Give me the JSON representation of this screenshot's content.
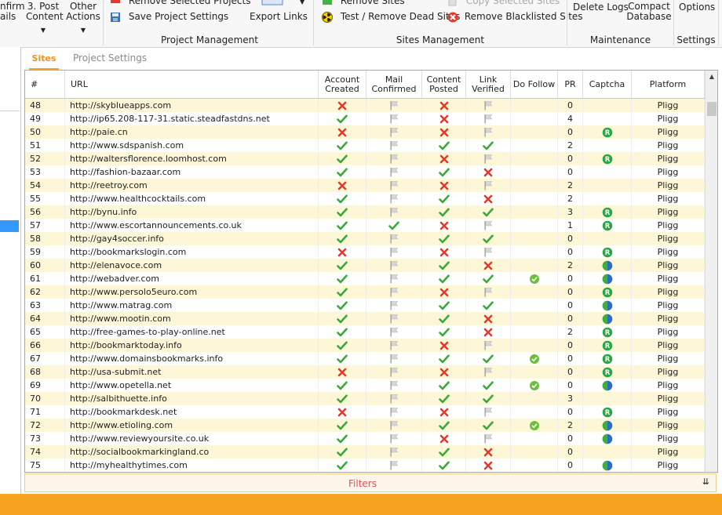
{
  "ribbon": {
    "left_partial_1": "nfirm",
    "left_partial_2": "ails",
    "post_content": [
      "3. Post",
      "Content"
    ],
    "other_actions": [
      "Other",
      "Actions"
    ],
    "remove_selected_projects": "Remove Selected Projects",
    "save_project_settings": "Save Project Settings",
    "export_links": "Export Links",
    "remove_sites": "Remove Sites",
    "copy_selected_sites": "Copy Selected Sites",
    "test_remove_dead_sites": "Test / Remove Dead Sites",
    "remove_blacklisted_sites": "Remove Blacklisted Sites",
    "delete_logs": "Delete Logs",
    "compact_database": [
      "Compact",
      "Database"
    ],
    "options": "Options",
    "groups": {
      "project_management": "Project Management",
      "sites_management": "Sites Management",
      "maintenance": "Maintenance",
      "settings": "Settings"
    }
  },
  "tabs": {
    "sites": "Sites",
    "project_settings": "Project Settings"
  },
  "columns": {
    "num": "#",
    "url": "URL",
    "account_created": [
      "Account",
      "Created"
    ],
    "mail_confirmed": [
      "Mail",
      "Confirmed"
    ],
    "content_posted": [
      "Content",
      "Posted"
    ],
    "link_verified": [
      "Link",
      "Verified"
    ],
    "do_follow": "Do Follow",
    "pr": "PR",
    "captcha": "Captcha",
    "platform": "Platform"
  },
  "rows": [
    {
      "n": "48",
      "url": "http://skyblueapps.com",
      "ac": "x",
      "mc": "flag",
      "cp": "x",
      "lv": "flag",
      "df": "",
      "pr": "0",
      "cap": "",
      "pl": "Pligg"
    },
    {
      "n": "49",
      "url": "http://ip65.208-117-31.static.steadfastdns.net",
      "ac": "check",
      "mc": "flag",
      "cp": "x",
      "lv": "flag",
      "df": "",
      "pr": "4",
      "cap": "",
      "pl": "Pligg"
    },
    {
      "n": "50",
      "url": "http://paie.cn",
      "ac": "x",
      "mc": "flag",
      "cp": "x",
      "lv": "flag",
      "df": "",
      "pr": "0",
      "cap": "R",
      "pl": "Pligg"
    },
    {
      "n": "51",
      "url": "http://www.sdspanish.com",
      "ac": "check",
      "mc": "flag",
      "cp": "check",
      "lv": "check",
      "df": "",
      "pr": "2",
      "cap": "",
      "pl": "Pligg"
    },
    {
      "n": "52",
      "url": "http://waltersflorence.loomhost.com",
      "ac": "check",
      "mc": "flag",
      "cp": "x",
      "lv": "flag",
      "df": "",
      "pr": "0",
      "cap": "R",
      "pl": "Pligg"
    },
    {
      "n": "53",
      "url": "http://fashion-bazaar.com",
      "ac": "check",
      "mc": "flag",
      "cp": "check",
      "lv": "x",
      "df": "",
      "pr": "0",
      "cap": "",
      "pl": "Pligg"
    },
    {
      "n": "54",
      "url": "http://reetroy.com",
      "ac": "x",
      "mc": "flag",
      "cp": "x",
      "lv": "flag",
      "df": "",
      "pr": "2",
      "cap": "",
      "pl": "Pligg"
    },
    {
      "n": "55",
      "url": "http://www.healthcocktails.com",
      "ac": "check",
      "mc": "flag",
      "cp": "check",
      "lv": "x",
      "df": "",
      "pr": "2",
      "cap": "",
      "pl": "Pligg"
    },
    {
      "n": "56",
      "url": "http://bynu.info",
      "ac": "check",
      "mc": "flag",
      "cp": "check",
      "lv": "check",
      "df": "",
      "pr": "3",
      "cap": "R",
      "pl": "Pligg"
    },
    {
      "n": "57",
      "url": "http://www.escortannouncements.co.uk",
      "ac": "check",
      "mc": "check",
      "cp": "x",
      "lv": "flag",
      "df": "",
      "pr": "1",
      "cap": "R",
      "pl": "Pligg"
    },
    {
      "n": "58",
      "url": "http://gay4soccer.info",
      "ac": "check",
      "mc": "flag",
      "cp": "check",
      "lv": "check",
      "df": "",
      "pr": "0",
      "cap": "",
      "pl": "Pligg"
    },
    {
      "n": "59",
      "url": "http://bookmarkslogin.com",
      "ac": "x",
      "mc": "flag",
      "cp": "x",
      "lv": "flag",
      "df": "",
      "pr": "0",
      "cap": "R",
      "pl": "Pligg"
    },
    {
      "n": "60",
      "url": "http://elenavoce.com",
      "ac": "check",
      "mc": "flag",
      "cp": "check",
      "lv": "x",
      "df": "",
      "pr": "2",
      "cap": "half",
      "pl": "Pligg"
    },
    {
      "n": "61",
      "url": "http://webadver.com",
      "ac": "check",
      "mc": "flag",
      "cp": "check",
      "lv": "check",
      "df": "dot",
      "pr": "0",
      "cap": "half",
      "pl": "Pligg"
    },
    {
      "n": "62",
      "url": "http://www.persolo5euro.com",
      "ac": "check",
      "mc": "flag",
      "cp": "x",
      "lv": "flag",
      "df": "",
      "pr": "0",
      "cap": "R",
      "pl": "Pligg"
    },
    {
      "n": "63",
      "url": "http://www.matrag.com",
      "ac": "check",
      "mc": "flag",
      "cp": "check",
      "lv": "check",
      "df": "",
      "pr": "0",
      "cap": "half",
      "pl": "Pligg"
    },
    {
      "n": "64",
      "url": "http://www.mootin.com",
      "ac": "check",
      "mc": "flag",
      "cp": "check",
      "lv": "x",
      "df": "",
      "pr": "0",
      "cap": "half",
      "pl": "Pligg"
    },
    {
      "n": "65",
      "url": "http://free-games-to-play-online.net",
      "ac": "check",
      "mc": "flag",
      "cp": "check",
      "lv": "x",
      "df": "",
      "pr": "2",
      "cap": "R",
      "pl": "Pligg"
    },
    {
      "n": "66",
      "url": "http://bookmarktoday.info",
      "ac": "check",
      "mc": "flag",
      "cp": "x",
      "lv": "flag",
      "df": "",
      "pr": "0",
      "cap": "R",
      "pl": "Pligg"
    },
    {
      "n": "67",
      "url": "http://www.domainsbookmarks.info",
      "ac": "check",
      "mc": "flag",
      "cp": "check",
      "lv": "check",
      "df": "dot",
      "pr": "0",
      "cap": "R",
      "pl": "Pligg"
    },
    {
      "n": "68",
      "url": "http://usa-submit.net",
      "ac": "x",
      "mc": "flag",
      "cp": "x",
      "lv": "flag",
      "df": "",
      "pr": "0",
      "cap": "R",
      "pl": "Pligg"
    },
    {
      "n": "69",
      "url": "http://www.opetella.net",
      "ac": "check",
      "mc": "flag",
      "cp": "check",
      "lv": "check",
      "df": "dot",
      "pr": "0",
      "cap": "half",
      "pl": "Pligg"
    },
    {
      "n": "70",
      "url": "http://salbithuette.info",
      "ac": "check",
      "mc": "flag",
      "cp": "check",
      "lv": "check",
      "df": "",
      "pr": "3",
      "cap": "",
      "pl": "Pligg"
    },
    {
      "n": "71",
      "url": "http://bookmarkdesk.net",
      "ac": "x",
      "mc": "flag",
      "cp": "x",
      "lv": "flag",
      "df": "",
      "pr": "0",
      "cap": "R",
      "pl": "Pligg"
    },
    {
      "n": "72",
      "url": "http://www.etioling.com",
      "ac": "check",
      "mc": "flag",
      "cp": "check",
      "lv": "check",
      "df": "dot",
      "pr": "2",
      "cap": "half",
      "pl": "Pligg"
    },
    {
      "n": "73",
      "url": "http://www.reviewyoursite.co.uk",
      "ac": "check",
      "mc": "flag",
      "cp": "x",
      "lv": "flag",
      "df": "",
      "pr": "0",
      "cap": "half",
      "pl": "Pligg"
    },
    {
      "n": "74",
      "url": "http://socialbookmarkingland.co",
      "ac": "check",
      "mc": "flag",
      "cp": "check",
      "lv": "x",
      "df": "",
      "pr": "0",
      "cap": "",
      "pl": "Pligg"
    },
    {
      "n": "75",
      "url": "http://myhealthytimes.com",
      "ac": "check",
      "mc": "flag",
      "cp": "check",
      "lv": "x",
      "df": "",
      "pr": "0",
      "cap": "half",
      "pl": "Pligg"
    }
  ],
  "filters": {
    "label": "Filters"
  },
  "colors": {
    "accent_orange": "#f7a421",
    "row_alt": "#fdf7d7",
    "check_green": "#3aa83a",
    "x_red": "#e23b2e",
    "flag_gray": "#bdbdbd",
    "tab_orange": "#f0901e",
    "filters_red": "#d9534f"
  }
}
